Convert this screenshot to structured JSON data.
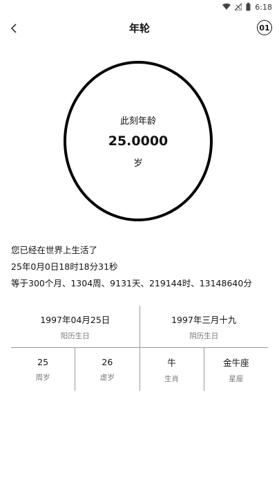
{
  "status_bar": {
    "time": "6:18",
    "icons": [
      "wifi-icon",
      "signal-icon",
      "battery-icon"
    ]
  },
  "app_bar": {
    "title": "年轮",
    "counter": "01"
  },
  "age": {
    "label": "此刻年龄",
    "value": "25.0000",
    "unit": "岁"
  },
  "summary": {
    "line1": "您已经在世界上生活了",
    "line2": "25年0月0日18时18分31秒",
    "line3": "等于300个月、1304周、9131天、219144时、13148640分"
  },
  "info": {
    "solar_birthday": {
      "value": "1997年04月25日",
      "label": "阳历生日"
    },
    "lunar_birthday": {
      "value": "1997年三月十九",
      "label": "阴历生日"
    },
    "full_age": {
      "value": "25",
      "label": "周岁"
    },
    "nominal_age": {
      "value": "26",
      "label": "虚岁"
    },
    "zodiac": {
      "value": "牛",
      "label": "生肖"
    },
    "constellation": {
      "value": "金牛座",
      "label": "星座"
    }
  }
}
